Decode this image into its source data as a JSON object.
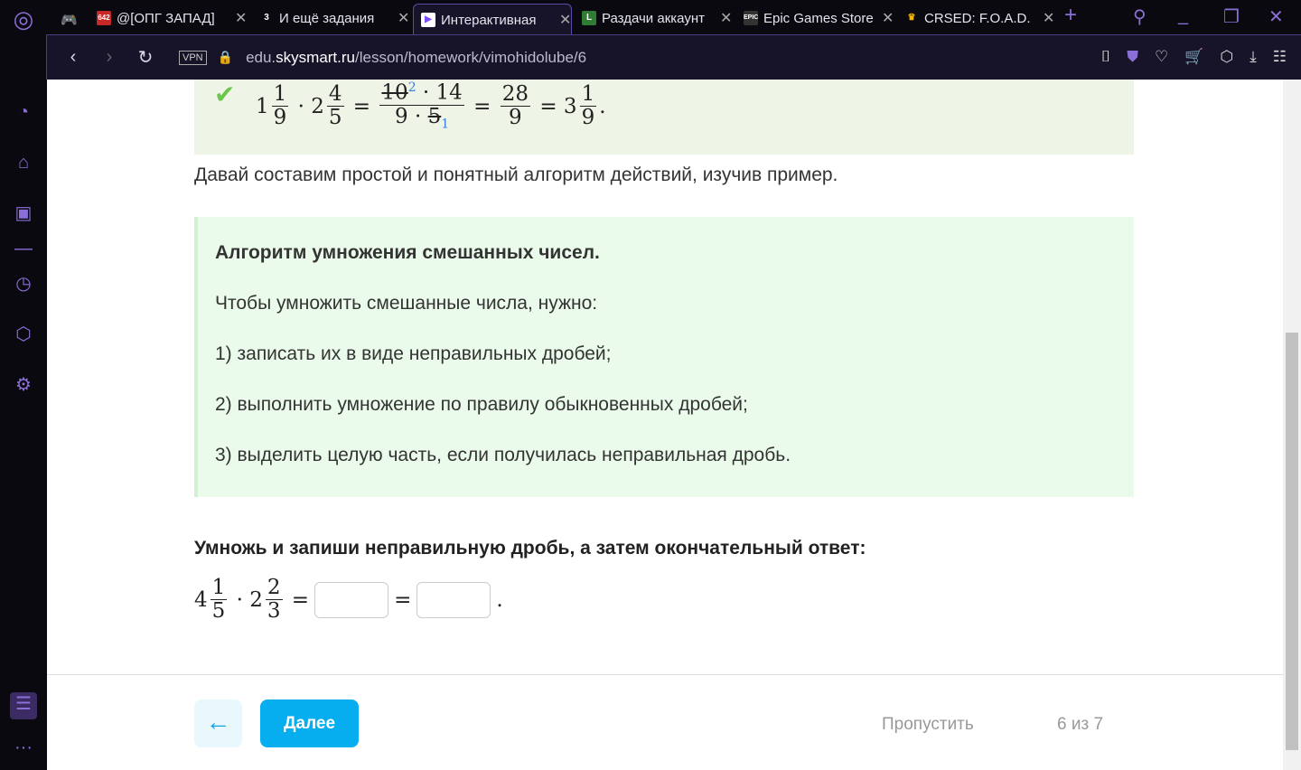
{
  "browser": {
    "tabs": [
      {
        "title": "@[ОПГ ЗАПАД]",
        "badge": "642",
        "icon": "discord-icon"
      },
      {
        "title": "И ещё задания",
        "badge": "3",
        "icon": "number-icon"
      },
      {
        "title": "Интерактивная",
        "icon": "skysmart-icon",
        "active": true
      },
      {
        "title": "Раздачи аккаунт",
        "icon": "l-icon"
      },
      {
        "title": "Epic Games Store",
        "icon": "epic-icon"
      },
      {
        "title": "CRSED: F.O.A.D.",
        "icon": "crown-icon"
      }
    ],
    "vpn": "VPN",
    "url_domain_prefix": "edu.",
    "url_domain": "skysmart.ru",
    "url_path": "/lesson/homework/vimohidolube/6"
  },
  "example": {
    "whole1": "1",
    "n1": "1",
    "d1": "9",
    "whole2": "2",
    "n2": "4",
    "d2": "5",
    "num_a": "10",
    "num_a_reduced": "2",
    "num_b": "14",
    "den_a": "9",
    "den_b": "5",
    "den_b_reduced": "1",
    "res_n": "28",
    "res_d": "9",
    "final_whole": "3",
    "final_n": "1",
    "final_d": "9"
  },
  "intro": "Давай составим простой и понятный алгоритм действий, изучив пример.",
  "algorithm": {
    "title": "Алгоритм умножения смешанных чисел.",
    "lead": "Чтобы умножить смешанные числа, нужно:",
    "steps": [
      "1) записать их в виде неправильных дробей;",
      "2) выполнить умножение по правилу обыкновенных дробей;",
      "3) выделить целую часть, если получилась неправильная дробь."
    ]
  },
  "task": {
    "prompt": "Умножь и запиши неправильную дробь, а затем окончательный ответ:",
    "whole1": "4",
    "n1": "1",
    "d1": "5",
    "whole2": "2",
    "n2": "2",
    "d2": "3",
    "answer1": "",
    "answer2": ""
  },
  "footer": {
    "next": "Далее",
    "skip": "Пропустить",
    "progress": "6 из 7"
  }
}
